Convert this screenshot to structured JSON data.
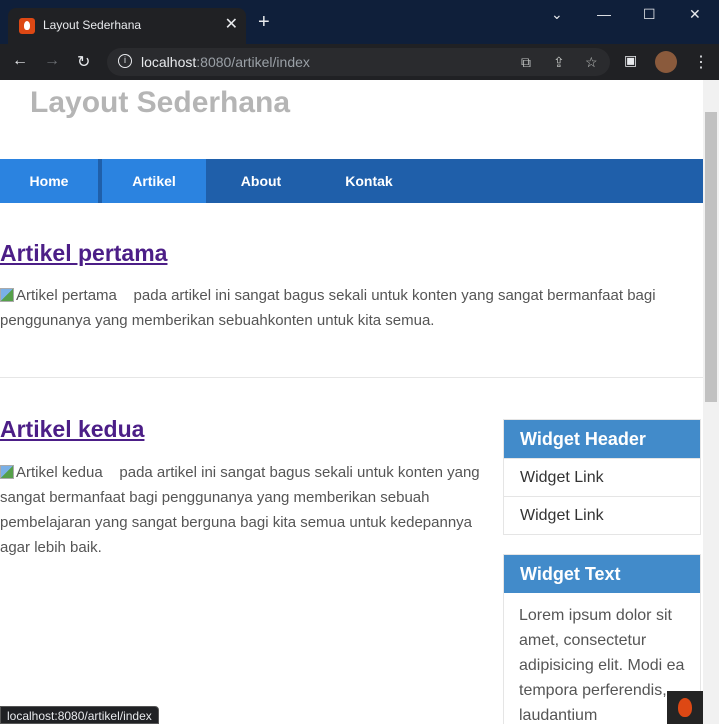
{
  "browser": {
    "tab_title": "Layout Sederhana",
    "url_host": "localhost",
    "url_rest": ":8080/artikel/index",
    "status_url": "localhost:8080/artikel/index"
  },
  "site": {
    "title": "Layout Sederhana",
    "nav": [
      "Home",
      "Artikel",
      "About",
      "Kontak"
    ],
    "active_nav": "Artikel"
  },
  "articles": [
    {
      "title": "Artikel pertama",
      "image_alt": "Artikel pertama",
      "body": "pada artikel ini sangat bagus sekali untuk konten yang sangat bermanfaat bagi penggunanya yang memberikan sebuahkonten untuk kita semua."
    },
    {
      "title": "Artikel kedua",
      "image_alt": "Artikel kedua",
      "body": "pada artikel ini sangat bagus sekali untuk konten yang sangat bermanfaat bagi penggunanya yang memberikan sebuah pembelajaran yang sangat berguna bagi kita semua untuk kedepannya agar lebih baik."
    }
  ],
  "sidebar": {
    "widget1": {
      "header": "Widget Header",
      "links": [
        "Widget Link",
        "Widget Link"
      ]
    },
    "widget2": {
      "header": "Widget Text",
      "text": "Lorem ipsum dolor sit amet, consectetur adipisicing elit. Modi ea tempora perferendis, laudantium"
    }
  },
  "icons": [
    "site-favicon-icon",
    "close-tab-icon",
    "new-tab-icon",
    "minimize-icon",
    "maximize-icon",
    "close-window-icon",
    "back-icon",
    "forward-icon",
    "reload-icon",
    "info-icon",
    "translate-icon",
    "share-icon",
    "bookmark-star-icon",
    "side-panel-icon",
    "profile-avatar",
    "menu-icon",
    "codeigniter-toolbar-icon"
  ]
}
